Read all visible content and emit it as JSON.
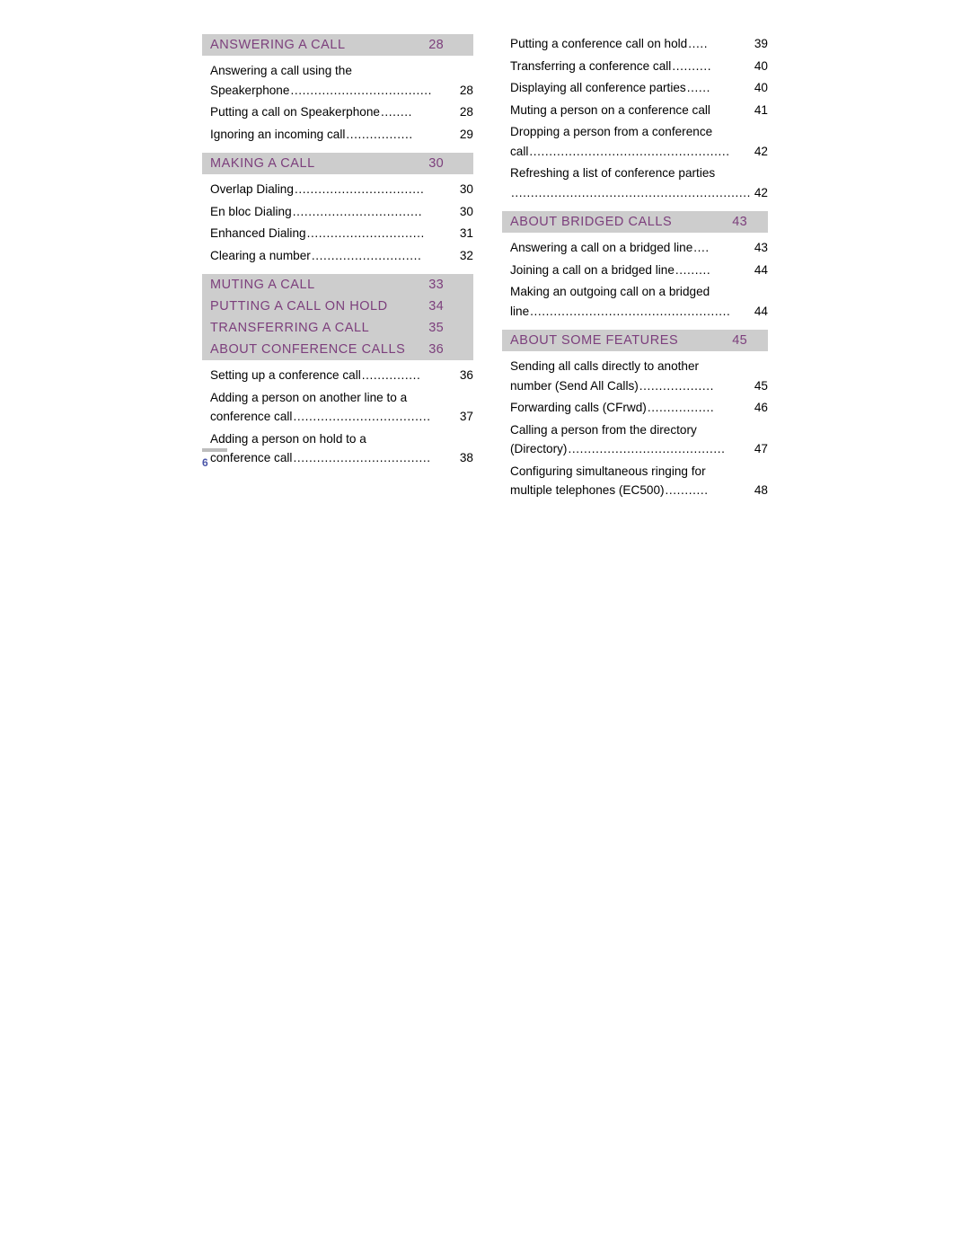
{
  "document": {
    "folio_number": "6",
    "colors": {
      "heading_bar_background": "#cdcdcd",
      "heading_text": "#7c3f7c",
      "body_text": "#000000",
      "folio_text": "#4a55a8",
      "folio_rule": "#bdbdbd"
    }
  },
  "left_column": {
    "blocks": [
      {
        "type": "heading_bar",
        "rows": [
          {
            "title": "ANSWERING A CALL",
            "page": "28"
          }
        ]
      },
      {
        "type": "entries",
        "items": [
          {
            "text": "Answering a call using the",
            "text2": "Speakerphone",
            "page": "28",
            "wrapped": true,
            "leader": "...................................."
          },
          {
            "text": "Putting a call on Speakerphone",
            "page": "28",
            "wrapped": false,
            "leader": "........"
          },
          {
            "text": "Ignoring an incoming call",
            "page": "29",
            "wrapped": false,
            "leader": "................."
          }
        ]
      },
      {
        "type": "heading_bar",
        "rows": [
          {
            "title": "MAKING A CALL",
            "page": "30"
          }
        ]
      },
      {
        "type": "entries",
        "items": [
          {
            "text": "Overlap Dialing",
            "page": "30",
            "wrapped": false,
            "leader": "................................."
          },
          {
            "text": "En bloc Dialing",
            "page": "30",
            "wrapped": false,
            "leader": "................................."
          },
          {
            "text": "Enhanced Dialing",
            "page": "31",
            "wrapped": false,
            "leader": ".............................."
          },
          {
            "text": "Clearing a number",
            "page": "32",
            "wrapped": false,
            "leader": "............................"
          }
        ]
      },
      {
        "type": "heading_bar",
        "rows": [
          {
            "title": "MUTING A CALL",
            "page": "33"
          },
          {
            "title": "PUTTING A CALL ON HOLD",
            "page": "34"
          },
          {
            "title": "TRANSFERRING A CALL",
            "page": "35"
          },
          {
            "title": "ABOUT CONFERENCE CALLS",
            "page": "36"
          }
        ]
      },
      {
        "type": "entries",
        "items": [
          {
            "text": "Setting up a conference call",
            "page": "36",
            "wrapped": false,
            "leader": "..............."
          },
          {
            "text": "Adding a person on another line to a",
            "text2": "conference call",
            "page": "37",
            "wrapped": true,
            "leader": "..................................."
          },
          {
            "text": "Adding a person on hold to a",
            "text2": "conference call",
            "page": "38",
            "wrapped": true,
            "leader": "..................................."
          }
        ]
      }
    ]
  },
  "right_column": {
    "blocks": [
      {
        "type": "entries",
        "items": [
          {
            "text": "Putting a conference call on hold",
            "page": "39",
            "wrapped": false,
            "leader": "....."
          },
          {
            "text": "Transferring a conference call",
            "page": "40",
            "wrapped": false,
            "leader": ".........."
          },
          {
            "text": "Displaying all conference parties",
            "page": "40",
            "wrapped": false,
            "leader": "......"
          },
          {
            "text": "Muting a person on a conference call",
            "page": "41",
            "wrapped": false,
            "leader": ""
          },
          {
            "text": "Dropping a person from a conference",
            "text2": "call",
            "page": "42",
            "wrapped": true,
            "leader": "..................................................."
          },
          {
            "text": "Refreshing a list of conference parties",
            "text2": "",
            "page": "42",
            "wrapped": true,
            "leader": "............................................................."
          }
        ]
      },
      {
        "type": "heading_bar",
        "rows": [
          {
            "title": "ABOUT BRIDGED CALLS",
            "page": "43"
          }
        ]
      },
      {
        "type": "entries",
        "items": [
          {
            "text": "Answering a call on a bridged line",
            "page": "43",
            "wrapped": false,
            "leader": "...."
          },
          {
            "text": "Joining a call on a bridged line",
            "page": "44",
            "wrapped": false,
            "leader": "........."
          },
          {
            "text": "Making an outgoing call on a bridged",
            "text2": "line",
            "page": "44",
            "wrapped": true,
            "leader": "..................................................."
          }
        ]
      },
      {
        "type": "heading_bar",
        "rows": [
          {
            "title": "ABOUT SOME FEATURES",
            "page": "45"
          }
        ]
      },
      {
        "type": "entries",
        "items": [
          {
            "text": "Sending all calls directly to another",
            "text2": "number (Send All Calls)",
            "page": "45",
            "wrapped": true,
            "leader": "..................."
          },
          {
            "text": "Forwarding calls (CFrwd)",
            "page": "46",
            "wrapped": false,
            "leader": "................."
          },
          {
            "text": "Calling a person from the directory",
            "text2": "(Directory)",
            "page": "47",
            "wrapped": true,
            "leader": "........................................"
          },
          {
            "text": "Configuring simultaneous ringing for",
            "text2": "multiple telephones (EC500)",
            "page": "48",
            "wrapped": true,
            "leader": "..........."
          }
        ]
      }
    ]
  }
}
